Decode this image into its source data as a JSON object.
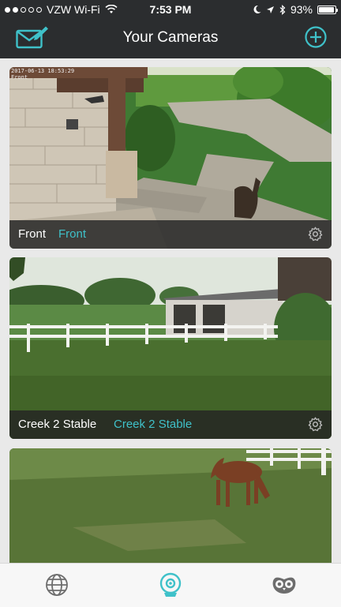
{
  "status": {
    "carrier": "VZW Wi-Fi",
    "time": "7:53 PM",
    "battery": "93%",
    "battery_level": 0.93
  },
  "header": {
    "title": "Your Cameras",
    "left_icon": "mail-edit-icon",
    "right_icon": "add-circle-icon"
  },
  "cameras": [
    {
      "name": "Front",
      "location": "Front",
      "timestamp_line1": "2017-06-13 18:53:29",
      "timestamp_line2": "Front"
    },
    {
      "name": "Creek 2 Stable",
      "location": "Creek 2 Stable"
    },
    {
      "name": "",
      "location": ""
    }
  ],
  "tabs": [
    {
      "icon": "globe-icon"
    },
    {
      "icon": "camera-icon"
    },
    {
      "icon": "owl-icon"
    }
  ],
  "colors": {
    "accent": "#3fc1c9",
    "header_bg": "#2b2d2f"
  }
}
